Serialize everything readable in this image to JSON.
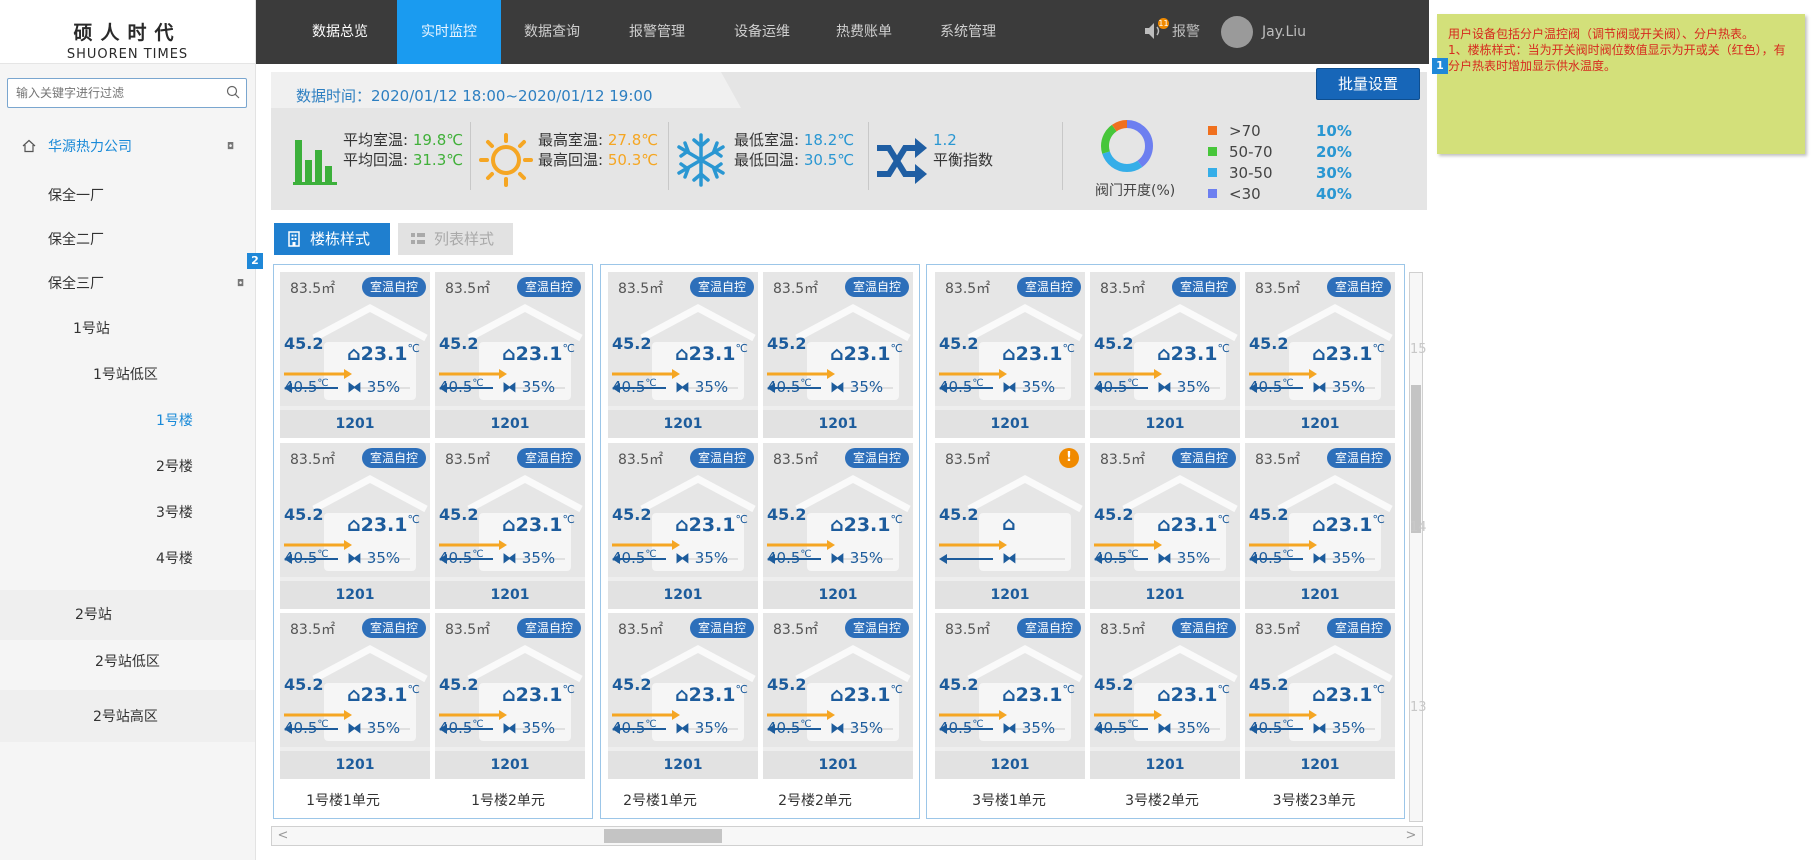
{
  "logo": {
    "cn": "硕人时代",
    "en": "SHUOREN  TIMES"
  },
  "search": {
    "placeholder": "输入关键字进行过滤"
  },
  "tree": {
    "company": "华源热力公司",
    "plants": [
      "保全一厂",
      "保全二厂",
      "保全三厂"
    ],
    "stations": [
      "1号站",
      "2号站"
    ],
    "zones": [
      "1号站低区",
      "2号站低区",
      "2号站高区"
    ],
    "buildings": [
      "1号楼",
      "2号楼",
      "3号楼",
      "4号楼"
    ],
    "active": "1号楼"
  },
  "nav": {
    "items": [
      "数据总览",
      "实时监控",
      "数据查询",
      "报警管理",
      "设备运维",
      "热费账单",
      "系统管理"
    ],
    "active": "实时监控",
    "alarm_badge": "11",
    "alarm_label": "报警",
    "user": "Jay.Liu"
  },
  "stats": {
    "time_label": "数据时间：",
    "time_range": "2020/01/12  18:00~2020/01/12  19:00",
    "avg_room_label": "平均室温:",
    "avg_room": "19.8℃",
    "avg_return_label": "平均回温:",
    "avg_return": "31.3℃",
    "max_room_label": "最高室温:",
    "max_room": "27.8℃",
    "max_return_label": "最高回温:",
    "max_return": "50.3℃",
    "min_room_label": "最低室温:",
    "min_room": "18.2℃",
    "min_return_label": "最低回温:",
    "min_return": "30.5℃",
    "balance_value": "1.2",
    "balance_label": "平衡指数",
    "valve_label": "阀门开度(%)",
    "valve_legend": [
      {
        "range": ">70",
        "pct": "10%",
        "color": "#f0701e"
      },
      {
        "range": "50-70",
        "pct": "20%",
        "color": "#47c63a"
      },
      {
        "range": "30-50",
        "pct": "30%",
        "color": "#35aee8"
      },
      {
        "range": "<30",
        "pct": "40%",
        "color": "#6d7ff0"
      }
    ],
    "batch_button": "批量设置"
  },
  "view_tabs": {
    "building": "楼栋样式",
    "list": "列表样式"
  },
  "card_template": {
    "area": "83.5㎡",
    "mode": "室温自控",
    "supply": "45.2",
    "room_temp": "23.1",
    "temp_unit": "℃",
    "return_temp": "40.5",
    "valve": "35%",
    "room_no": "1201",
    "warn_symbol": "!"
  },
  "unit_labels": [
    "1号楼1单元",
    "1号楼2单元",
    "2号楼1单元",
    "2号楼2单元",
    "3号楼1单元",
    "3号楼2单元",
    "3号楼23单元"
  ],
  "row_numbers": [
    "15",
    "14",
    "13"
  ],
  "scroll": {
    "left": "<",
    "right": ">"
  },
  "note": {
    "line1": "用户设备包括分户温控阀（调节阀或开关阀）、分户热表。",
    "line2": "1、楼栋样式：当为开关阀时阀位数值显示为开或关（红色），有分户热表时增加显示供水温度。"
  },
  "markers": [
    "1",
    "2"
  ],
  "colors": {
    "accent": "#1a9bf0",
    "nav_bg": "#3b3b3b",
    "mode_badge": "#2d6fba",
    "warning": "#f08a00"
  }
}
